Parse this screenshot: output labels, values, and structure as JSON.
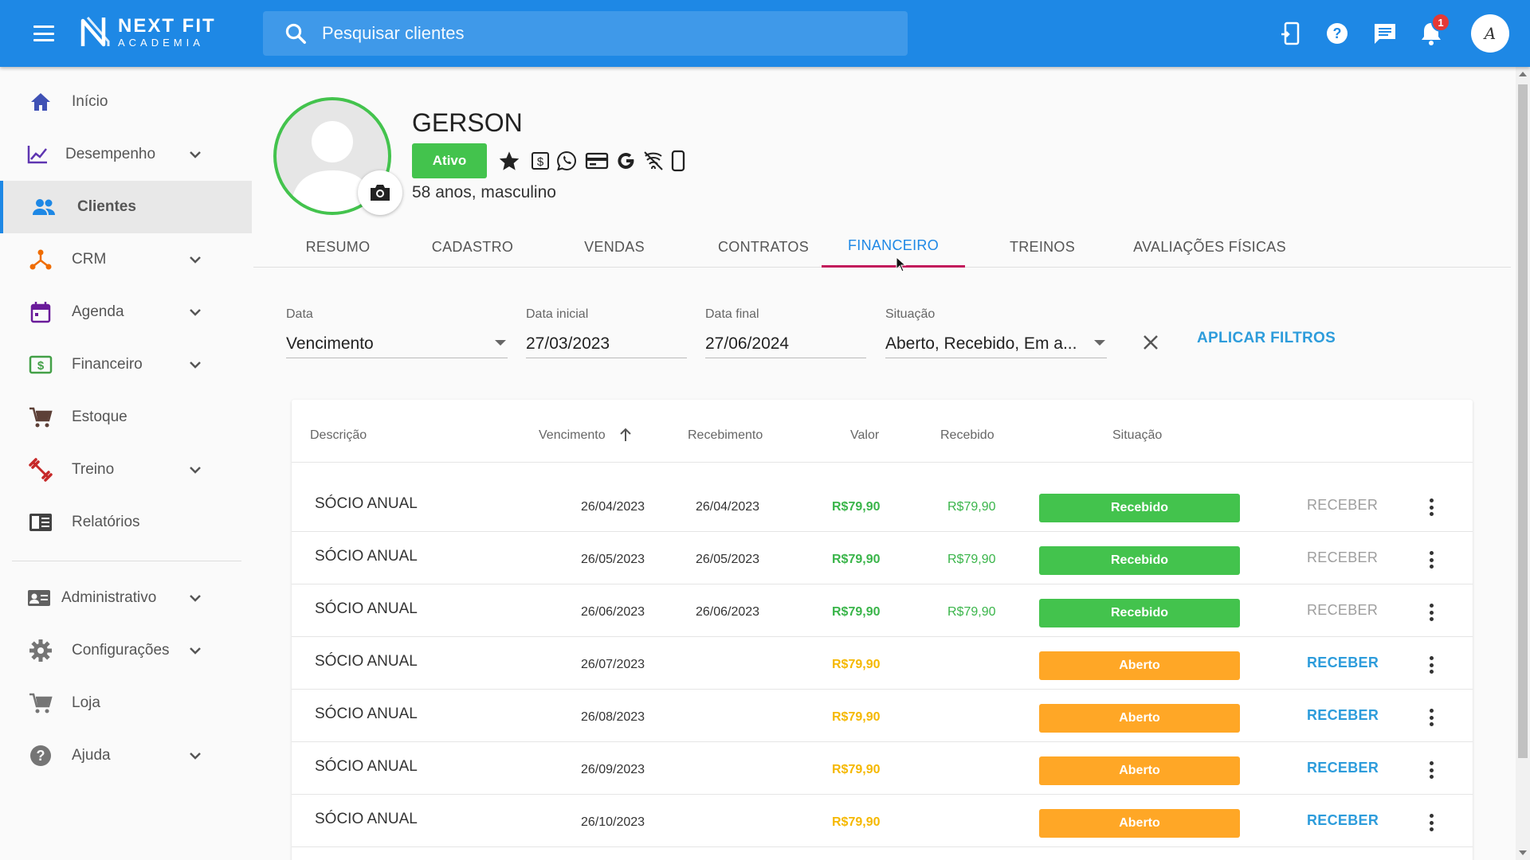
{
  "app": {
    "brand_line1": "NEXT FIT",
    "brand_line2": "ACADEMIA",
    "avatar_initial": "A"
  },
  "search": {
    "placeholder": "Pesquisar clientes"
  },
  "notifications": {
    "count": "1"
  },
  "sidebar": {
    "items": [
      {
        "label": "Início",
        "icon": "home-icon",
        "color": "#3f51b5"
      },
      {
        "label": "Desempenho",
        "icon": "chart-line-icon",
        "color": "#5e35b1"
      },
      {
        "label": "Clientes",
        "icon": "people-icon",
        "color": "#1e88e5"
      },
      {
        "label": "CRM",
        "icon": "crm-hub-icon",
        "color": "#ef6c00"
      },
      {
        "label": "Agenda",
        "icon": "calendar-icon",
        "color": "#6a1b9a"
      },
      {
        "label": "Financeiro",
        "icon": "money-icon",
        "color": "#43a047"
      },
      {
        "label": "Estoque",
        "icon": "cart-icon",
        "color": "#5d4037"
      },
      {
        "label": "Treino",
        "icon": "dumbbell-icon",
        "color": "#c62828"
      },
      {
        "label": "Relatórios",
        "icon": "report-icon",
        "color": "#424242"
      },
      {
        "label": "Administrativo",
        "icon": "id-card-icon",
        "color": "#616161"
      },
      {
        "label": "Configurações",
        "icon": "gear-icon",
        "color": "#757575"
      },
      {
        "label": "Loja",
        "icon": "store-cart-icon",
        "color": "#757575"
      },
      {
        "label": "Ajuda",
        "icon": "help-icon",
        "color": "#757575"
      }
    ]
  },
  "client": {
    "name": "GERSON",
    "status": "Ativo",
    "info": "58 anos, masculino",
    "status_color": "#43c34d"
  },
  "tabs": [
    {
      "label": "RESUMO"
    },
    {
      "label": "CADASTRO"
    },
    {
      "label": "VENDAS"
    },
    {
      "label": "CONTRATOS"
    },
    {
      "label": "FINANCEIRO"
    },
    {
      "label": "TREINOS"
    },
    {
      "label": "AVALIAÇÕES FÍSICAS"
    }
  ],
  "filters": {
    "data_label": "Data",
    "data_value": "Vencimento",
    "inicio_label": "Data inicial",
    "inicio_value": "27/03/2023",
    "fim_label": "Data final",
    "fim_value": "27/06/2024",
    "situacao_label": "Situação",
    "situacao_value": "Aberto, Recebido, Em a...",
    "apply_label": "APLICAR FILTROS"
  },
  "table": {
    "headers": {
      "descricao": "Descrição",
      "vencimento": "Vencimento",
      "recebimento": "Recebimento",
      "valor": "Valor",
      "recebido": "Recebido",
      "situacao": "Situação"
    },
    "rows": [
      {
        "descricao": "SÓCIO ANUAL",
        "vencimento": "26/04/2023",
        "recebimento": "26/04/2023",
        "valor": "R$79,90",
        "recebido": "R$79,90",
        "situacao": "Recebido",
        "acao": "RECEBER"
      },
      {
        "descricao": "SÓCIO ANUAL",
        "vencimento": "26/05/2023",
        "recebimento": "26/05/2023",
        "valor": "R$79,90",
        "recebido": "R$79,90",
        "situacao": "Recebido",
        "acao": "RECEBER"
      },
      {
        "descricao": "SÓCIO ANUAL",
        "vencimento": "26/06/2023",
        "recebimento": "26/06/2023",
        "valor": "R$79,90",
        "recebido": "R$79,90",
        "situacao": "Recebido",
        "acao": "RECEBER"
      },
      {
        "descricao": "SÓCIO ANUAL",
        "vencimento": "26/07/2023",
        "recebimento": "",
        "valor": "R$79,90",
        "recebido": "",
        "situacao": "Aberto",
        "acao": "RECEBER"
      },
      {
        "descricao": "SÓCIO ANUAL",
        "vencimento": "26/08/2023",
        "recebimento": "",
        "valor": "R$79,90",
        "recebido": "",
        "situacao": "Aberto",
        "acao": "RECEBER"
      },
      {
        "descricao": "SÓCIO ANUAL",
        "vencimento": "26/09/2023",
        "recebimento": "",
        "valor": "R$79,90",
        "recebido": "",
        "situacao": "Aberto",
        "acao": "RECEBER"
      },
      {
        "descricao": "SÓCIO ANUAL",
        "vencimento": "26/10/2023",
        "recebimento": "",
        "valor": "R$79,90",
        "recebido": "",
        "situacao": "Aberto",
        "acao": "RECEBER"
      }
    ]
  },
  "colors": {
    "primary": "#1e88e5",
    "recebido_green": "#43c34d",
    "aberto_orange": "#ffa726",
    "valor_green": "#3ab54a",
    "valor_yellow": "#f5b800",
    "receber_disabled": "#9e9e9e",
    "receber_active": "#2d9cdb",
    "tab_indicator": "#c2185b"
  }
}
